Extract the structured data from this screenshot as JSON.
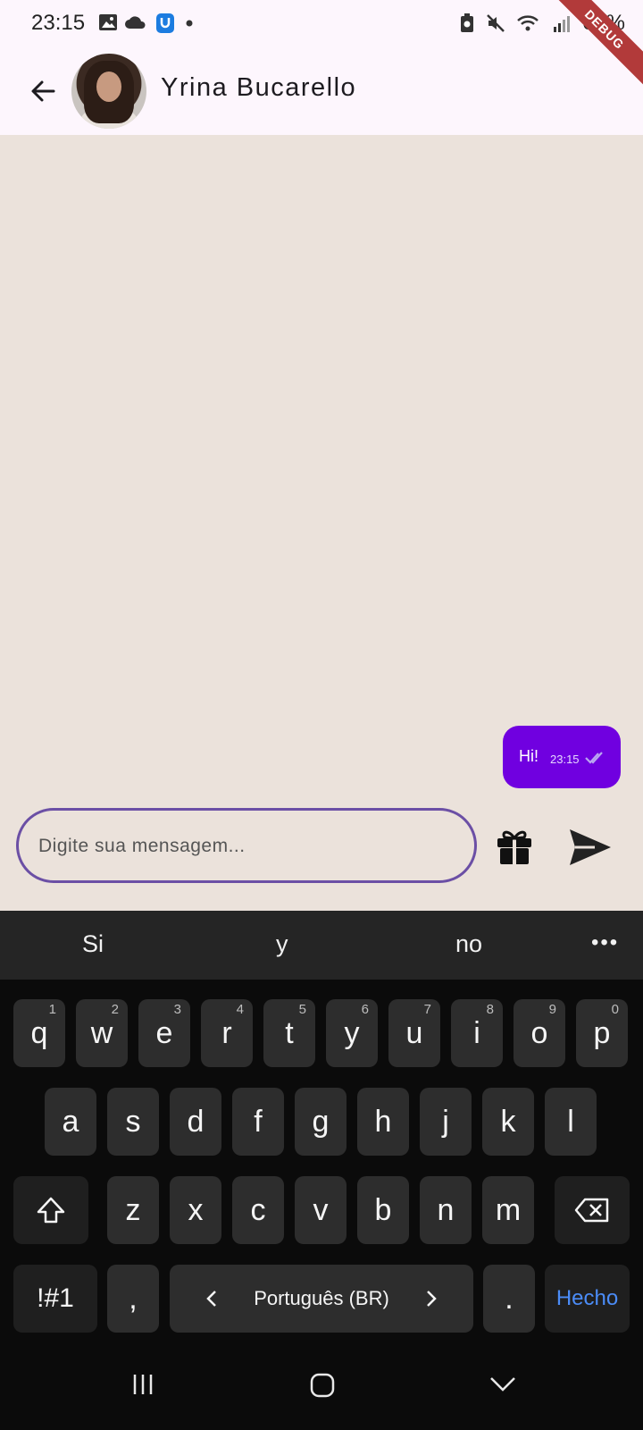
{
  "status_bar": {
    "time": "23:15",
    "battery_percent": "67%",
    "icons": [
      "image-icon",
      "cloud-icon",
      "app-notification-icon",
      "dot-icon",
      "battery-saver-icon",
      "mute-icon",
      "wifi-icon",
      "signal-icon"
    ]
  },
  "debug_ribbon": "DEBUG",
  "header": {
    "contact_name": "Yrina Bucarello"
  },
  "chat": {
    "messages": [
      {
        "text": "Hi!",
        "time": "23:15",
        "status": "read"
      }
    ]
  },
  "composer": {
    "placeholder": "Digite sua mensagem...",
    "value": "",
    "accent_color": "#6b4fa5"
  },
  "keyboard": {
    "suggestions": [
      "Si",
      "y",
      "no"
    ],
    "more_label": "•••",
    "row1": [
      {
        "key": "q",
        "num": "1"
      },
      {
        "key": "w",
        "num": "2"
      },
      {
        "key": "e",
        "num": "3"
      },
      {
        "key": "r",
        "num": "4"
      },
      {
        "key": "t",
        "num": "5"
      },
      {
        "key": "y",
        "num": "6"
      },
      {
        "key": "u",
        "num": "7"
      },
      {
        "key": "i",
        "num": "8"
      },
      {
        "key": "o",
        "num": "9"
      },
      {
        "key": "p",
        "num": "0"
      }
    ],
    "row2": [
      "a",
      "s",
      "d",
      "f",
      "g",
      "h",
      "j",
      "k",
      "l"
    ],
    "row3": [
      "z",
      "x",
      "c",
      "v",
      "b",
      "n",
      "m"
    ],
    "symbols_label": "!#1",
    "comma_label": ",",
    "language_label": "Português (BR)",
    "period_label": ".",
    "done_label": "Hecho",
    "done_color": "#4b8cf7"
  },
  "colors": {
    "bubble": "#7000e0",
    "chat_background": "#ebe2db",
    "app_bar": "#fdf6fd"
  }
}
